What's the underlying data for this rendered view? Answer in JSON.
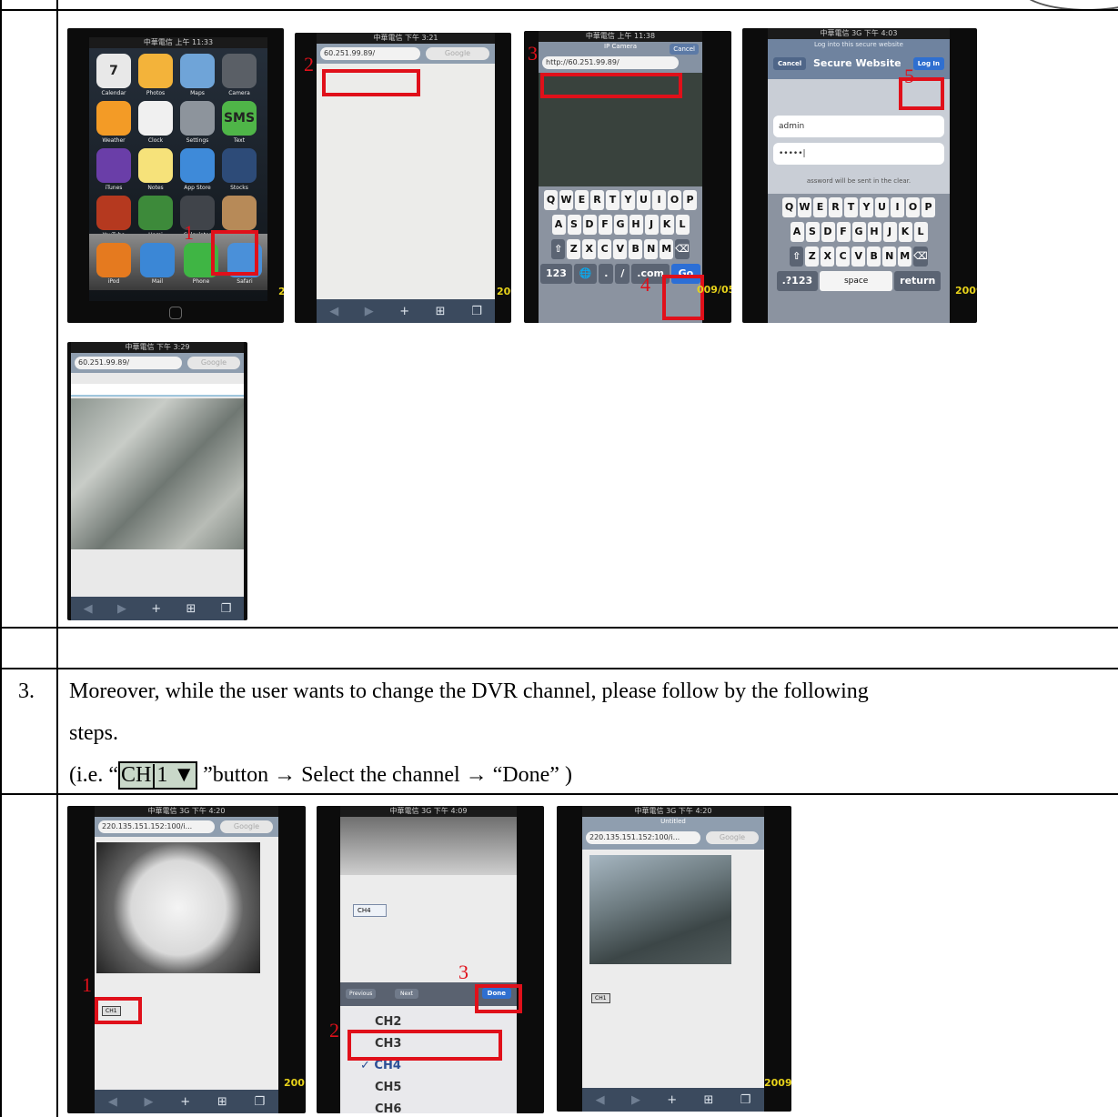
{
  "row1": {
    "shot1": {
      "status": "中華電信  上午 11:33",
      "apps": [
        {
          "label": "Calendar",
          "icon": "calendar-icon",
          "color": "#e8e8e8",
          "text": "7"
        },
        {
          "label": "Photos",
          "icon": "photos-icon",
          "color": "#f3b33a"
        },
        {
          "label": "Maps",
          "icon": "maps-icon",
          "color": "#6fa4d8"
        },
        {
          "label": "Camera",
          "icon": "camera-icon",
          "color": "#5a5f66"
        },
        {
          "label": "Weather",
          "icon": "weather-icon",
          "color": "#f39b26"
        },
        {
          "label": "Clock",
          "icon": "clock-icon",
          "color": "#f0f0f0"
        },
        {
          "label": "Settings",
          "icon": "settings-icon",
          "color": "#8d949c"
        },
        {
          "label": "Text",
          "icon": "sms-icon",
          "color": "#4fb548",
          "text": "SMS"
        },
        {
          "label": "iTunes",
          "icon": "itunes-icon",
          "color": "#6a3ea8"
        },
        {
          "label": "Notes",
          "icon": "notes-icon",
          "color": "#f6e27a"
        },
        {
          "label": "App Store",
          "icon": "app-store-icon",
          "color": "#3e8ad9"
        },
        {
          "label": "Stocks",
          "icon": "stocks-icon",
          "color": "#2d4b78"
        },
        {
          "label": "YouTube",
          "icon": "youtube-icon",
          "color": "#b5391f"
        },
        {
          "label": "Hami",
          "icon": "hami-icon",
          "color": "#3d8a3a"
        },
        {
          "label": "Calculator",
          "icon": "calculator-icon",
          "color": "#40444a"
        },
        {
          "label": "Contacts",
          "icon": "contacts-icon",
          "color": "#b78a58"
        }
      ],
      "dock": [
        {
          "label": "iPod",
          "icon": "ipod-icon",
          "color": "#e57a1f"
        },
        {
          "label": "Mail",
          "icon": "mail-icon",
          "color": "#3b87d6"
        },
        {
          "label": "Phone",
          "icon": "phone-icon",
          "color": "#3fb544"
        },
        {
          "label": "Safari",
          "icon": "safari-icon",
          "color": "#4a90d9"
        }
      ],
      "step": "1",
      "date": "2"
    },
    "shot2": {
      "status": "中華電信  下午 3:21",
      "url": "60.251.99.89/",
      "search": "Google",
      "step": "2",
      "date": "200"
    },
    "shot3": {
      "status": "中華電信  上午 11:38",
      "title": "IP Camera",
      "cancel": "Cancel",
      "url": "http://60.251.99.89/",
      "step": "3",
      "step2": "4",
      "go": "Go",
      "date": "009/05",
      "rows": [
        [
          "Q",
          "W",
          "E",
          "R",
          "T",
          "Y",
          "U",
          "I",
          "O",
          "P"
        ],
        [
          "A",
          "S",
          "D",
          "F",
          "G",
          "H",
          "J",
          "K",
          "L"
        ],
        [
          "⇧",
          "Z",
          "X",
          "C",
          "V",
          "B",
          "N",
          "M",
          "⌫"
        ]
      ],
      "bottom": [
        "123",
        "🌐",
        ".",
        "/",
        ".com"
      ]
    },
    "shot4": {
      "status": "中華電信 3G  下午 4:03",
      "prompt": "Log into this secure website",
      "cancel": "Cancel",
      "title": "Secure Website",
      "login": "Log In",
      "user": "admin",
      "pass": "•••••|",
      "note": "assword will be sent in the clear.",
      "step": "5",
      "date": "2009",
      "rows": [
        [
          "Q",
          "W",
          "E",
          "R",
          "T",
          "Y",
          "U",
          "I",
          "O",
          "P"
        ],
        [
          "A",
          "S",
          "D",
          "F",
          "G",
          "H",
          "J",
          "K",
          "L"
        ],
        [
          "⇧",
          "Z",
          "X",
          "C",
          "V",
          "B",
          "N",
          "M",
          "⌫"
        ]
      ],
      "bottom": [
        ".?123",
        "space",
        "return"
      ]
    },
    "shot5": {
      "status": "中華電信  下午 3:29",
      "url": "60.251.99.89/",
      "search": "Google"
    }
  },
  "section3": {
    "number": "3.",
    "line1": "Moreover, while the user wants to change the DVR channel, please follow by the following",
    "line2": "steps.",
    "line3_pre": "(i.e. “",
    "ch_a": "CH",
    "ch_b": "1 ▼",
    "line3_post": " ”button → Select the channel → “Done” )"
  },
  "row2": {
    "shot6": {
      "status": "中華電信 3G  下午 4:20",
      "url": "220.135.151.152:100/i...",
      "search": "Google",
      "channel": "CH1",
      "step": "1",
      "date": "200"
    },
    "shot7": {
      "status": "中華電信 3G  下午 4:09",
      "channel": "CH4",
      "prev": "Previous",
      "next": "Next",
      "done": "Done",
      "items": [
        "CH2",
        "CH3",
        "✓ CH4",
        "CH5",
        "CH6"
      ],
      "step": "3",
      "step2": "2"
    },
    "shot8": {
      "status": "中華電信 3G  下午 4:20",
      "title": "Untitled",
      "url": "220.135.151.152:100/i...",
      "search": "Google",
      "channel": "CH1",
      "date": "2009/"
    }
  }
}
